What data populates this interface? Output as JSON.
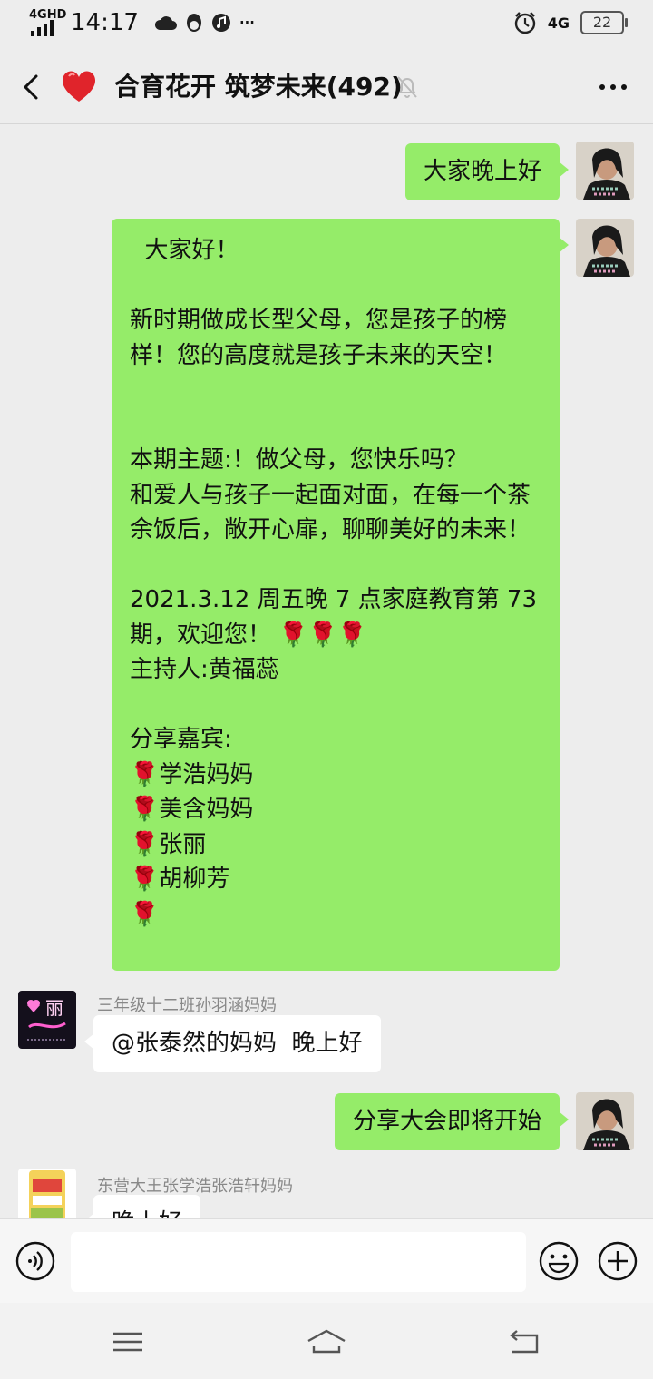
{
  "status_bar": {
    "network": "4GHD",
    "time": "14:17",
    "more": "···",
    "cell_type": "4G",
    "battery": "22"
  },
  "header": {
    "title": "合育花开 筑梦未来(492)",
    "more_icon": "more-icon",
    "back_icon": "back-arrow-icon"
  },
  "messages": [
    {
      "from": "me",
      "text": "大家晚上好"
    },
    {
      "from": "me",
      "text": "  大家好！\n\n新时期做成长型父母，您是孩子的榜样！您的高度就是孩子未来的天空！\n\n\n本期主题:！做父母，您快乐吗？\n和爱人与孩子一起面对面，在每一个茶余饭后，敞开心扉，聊聊美好的未来！\n\n2021.3.12 周五晚 7 点家庭教育第 73 期，欢迎您！ 🌹🌹🌹\n主持人:黄福蕊\n\n分享嘉宾:\n🌹学浩妈妈\n🌹美含妈妈\n🌹张丽\n🌹胡柳芳\n🌹"
    },
    {
      "from": "other",
      "sender": "三年级十二班孙羽涵妈妈",
      "text": "@张泰然的妈妈  晚上好",
      "avatar_text": "丽"
    },
    {
      "from": "me",
      "text": "分享大会即将开始"
    },
    {
      "from": "other",
      "sender": "东营大王张学浩张浩轩妈妈",
      "text": "晚上好"
    }
  ],
  "input": {
    "placeholder": ""
  },
  "colors": {
    "my_bubble": "#95ec69",
    "background": "#ededed",
    "heart": "#e0242b"
  }
}
